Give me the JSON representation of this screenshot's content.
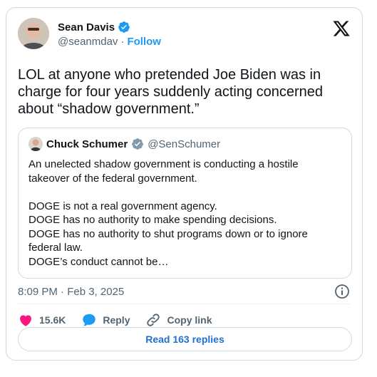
{
  "author": {
    "name": "Sean Davis",
    "handle": "@seanmdav",
    "follow_label": "Follow"
  },
  "tweet": {
    "text": "LOL at anyone who pretended Joe Biden was in\ncharge for four years suddenly acting concerned\nabout “shadow government.”",
    "timestamp": "8:09 PM · Feb 3, 2025"
  },
  "quote": {
    "name": "Chuck Schumer",
    "handle": "@SenSchumer",
    "text": "An unelected shadow government is conducting a hostile\ntakeover of the federal government.\n\nDOGE is not a real government agency.\nDOGE has no authority to make spending decisions.\nDOGE has no authority to shut programs down or to ignore\nfederal law.\nDOGE’s conduct cannot be…"
  },
  "actions": {
    "likes": "15.6K",
    "reply_label": "Reply",
    "copy_label": "Copy link"
  },
  "read_replies_label": "Read 163 replies",
  "icons": {
    "verified": "verified-badge-icon",
    "x_logo": "x-logo-icon",
    "info": "info-icon",
    "heart": "heart-icon",
    "reply": "reply-bubble-icon",
    "link": "link-icon"
  },
  "colors": {
    "accent": "#1d9bf0",
    "heart": "#f91880",
    "muted": "#536471",
    "border": "#cfd9de"
  }
}
